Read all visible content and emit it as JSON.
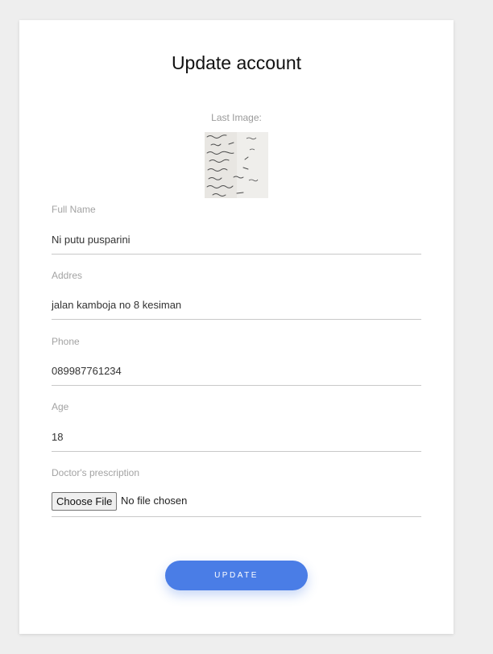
{
  "page": {
    "title": "Update account"
  },
  "last_image": {
    "label": "Last Image:"
  },
  "form": {
    "full_name": {
      "label": "Full Name",
      "value": "Ni putu pusparini"
    },
    "address": {
      "label": "Addres",
      "value": "jalan kamboja no 8 kesiman"
    },
    "phone": {
      "label": "Phone",
      "value": "089987761234"
    },
    "age": {
      "label": "Age",
      "value": "18"
    },
    "prescription": {
      "label": "Doctor's prescription",
      "button_label": "Choose File",
      "status": "No file chosen"
    }
  },
  "actions": {
    "update_label": "UPDATE"
  },
  "colors": {
    "accent": "#4a7de6",
    "background": "#eeeeee",
    "card": "#ffffff"
  }
}
